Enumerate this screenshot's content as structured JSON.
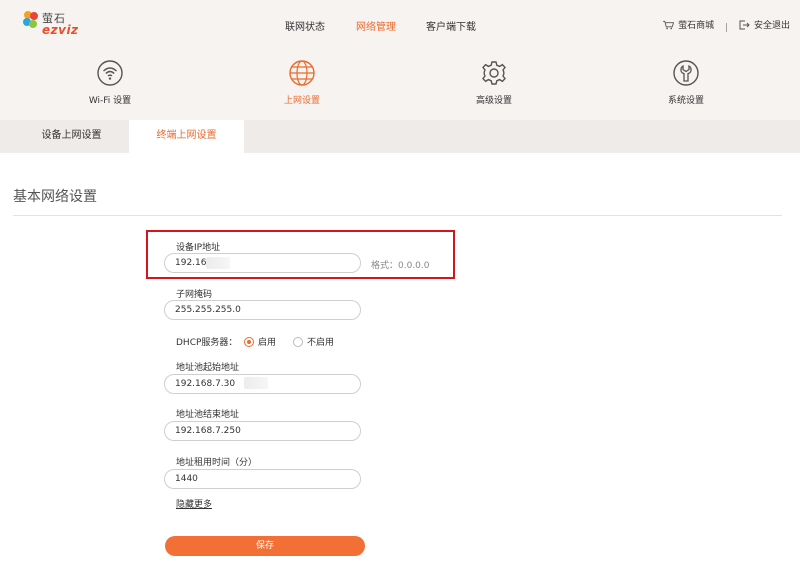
{
  "brand": {
    "name_cn": "萤石",
    "name_en": "ezviz"
  },
  "nav": {
    "items": [
      "联网状态",
      "网络管理",
      "客户端下载"
    ],
    "active": "网络管理"
  },
  "header_links": {
    "shop": "萤石商城",
    "separator": "|",
    "logout": "安全退出"
  },
  "features": [
    {
      "label": "Wi-Fi 设置",
      "icon": "wifi-icon"
    },
    {
      "label": "上网设置",
      "icon": "globe-icon",
      "active": true
    },
    {
      "label": "高级设置",
      "icon": "gear-icon"
    },
    {
      "label": "系统设置",
      "icon": "wrench-icon"
    }
  ],
  "subtabs": [
    {
      "label": "设备上网设置"
    },
    {
      "label": "终端上网设置",
      "active": true
    }
  ],
  "section": {
    "title": "基本网络设置"
  },
  "form": {
    "device_ip": {
      "label": "设备IP地址",
      "value": "192.168",
      "hint": "格式：0.0.0.0"
    },
    "subnet_mask": {
      "label": "子网掩码",
      "value": "255.255.255.0"
    },
    "dhcp": {
      "label": "DHCP服务器：",
      "options": [
        "启用",
        "不启用"
      ],
      "selected": "启用"
    },
    "pool_start": {
      "label": "地址池起始地址",
      "value": "192.168.7.30"
    },
    "pool_end": {
      "label": "地址池结束地址",
      "value": "192.168.7.250"
    },
    "lease_time": {
      "label": "地址租用时间（分）",
      "value": "1440"
    },
    "hide_more": "隐藏更多",
    "save": "保存"
  },
  "colors": {
    "accent": "#ec6a2c",
    "highlight_box": "#d7141a",
    "header_bg": "#f6f3f1",
    "save_button": "#f26f35"
  }
}
